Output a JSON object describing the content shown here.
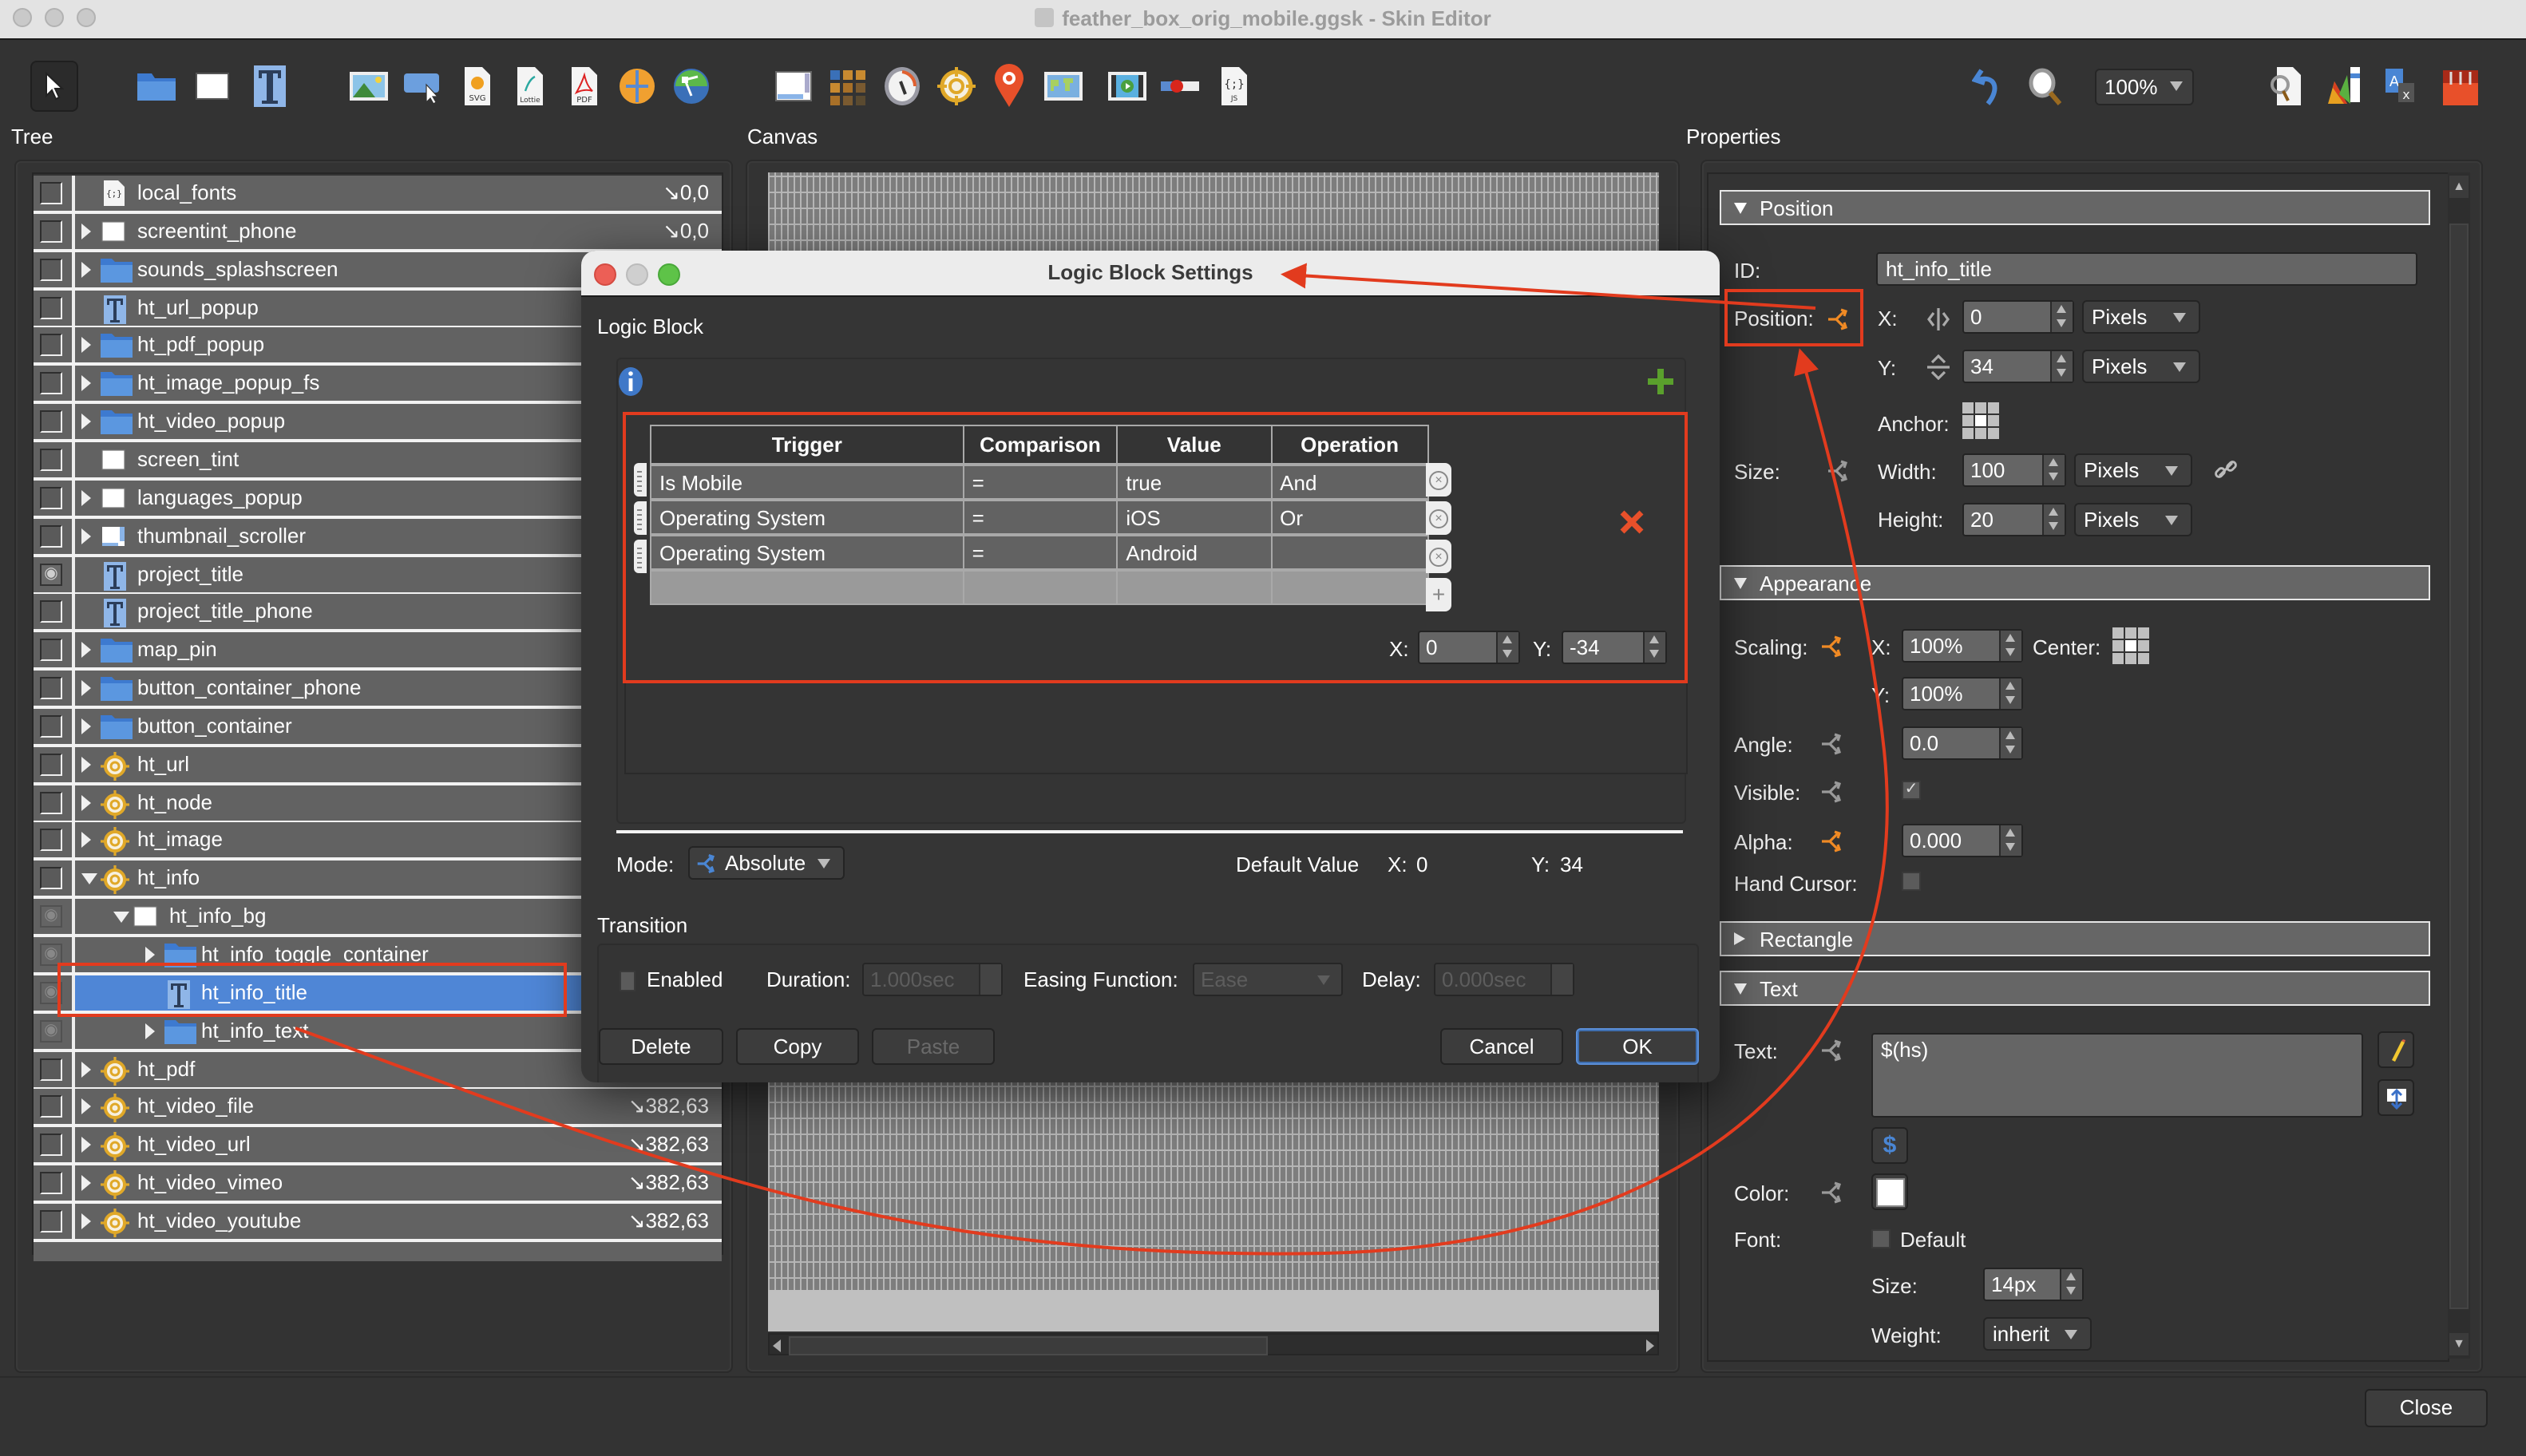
{
  "window": {
    "title": "feather_box_orig_mobile.ggsk - Skin Editor"
  },
  "toolbar": {
    "tools": [
      {
        "name": "select-tool-icon"
      },
      {
        "name": "container-icon"
      },
      {
        "name": "rectangle-icon"
      },
      {
        "name": "text-icon"
      },
      {
        "name": "image-icon"
      },
      {
        "name": "button-icon"
      },
      {
        "name": "svg-icon"
      },
      {
        "name": "lottie-icon"
      },
      {
        "name": "pdf-icon"
      },
      {
        "name": "cloner-icon"
      },
      {
        "name": "node-graph-icon"
      },
      {
        "name": "scrollarea-icon"
      },
      {
        "name": "grid-icon"
      },
      {
        "name": "compass-icon"
      },
      {
        "name": "hotspot-icon"
      },
      {
        "name": "map-pin-icon"
      },
      {
        "name": "map-icon"
      },
      {
        "name": "video-icon"
      },
      {
        "name": "slider-icon"
      },
      {
        "name": "javascript-icon"
      }
    ],
    "zoom_value": "100%",
    "right_tools": [
      {
        "name": "undo-icon"
      },
      {
        "name": "zoom-icon"
      },
      {
        "name": "find-icon"
      },
      {
        "name": "theme-icon"
      },
      {
        "name": "translate-icon"
      },
      {
        "name": "toolbox-icon"
      }
    ]
  },
  "tree": {
    "label": "Tree",
    "rows": [
      {
        "name": "local_fonts",
        "icon": "js",
        "depth": 0,
        "expander": "none",
        "value": "↘0,0",
        "visibility": "off"
      },
      {
        "name": "screentint_phone",
        "icon": "rect",
        "depth": 0,
        "expander": "right",
        "value": "↘0,0",
        "visibility": "off"
      },
      {
        "name": "sounds_splashscreen",
        "icon": "folder",
        "depth": 0,
        "expander": "right",
        "value": "",
        "visibility": "off"
      },
      {
        "name": "ht_url_popup",
        "icon": "text",
        "depth": 0,
        "expander": "none",
        "value": "",
        "visibility": "off"
      },
      {
        "name": "ht_pdf_popup",
        "icon": "folder",
        "depth": 0,
        "expander": "right",
        "value": "",
        "visibility": "off"
      },
      {
        "name": "ht_image_popup_fs",
        "icon": "folder",
        "depth": 0,
        "expander": "right",
        "value": "",
        "visibility": "off"
      },
      {
        "name": "ht_video_popup",
        "icon": "folder",
        "depth": 0,
        "expander": "right",
        "value": "",
        "visibility": "off"
      },
      {
        "name": "screen_tint",
        "icon": "rect",
        "depth": 0,
        "expander": "none",
        "value": "",
        "visibility": "off"
      },
      {
        "name": "languages_popup",
        "icon": "rect",
        "depth": 0,
        "expander": "right",
        "value": "",
        "visibility": "off"
      },
      {
        "name": "thumbnail_scroller",
        "icon": "scroller",
        "depth": 0,
        "expander": "right",
        "value": "",
        "visibility": "off"
      },
      {
        "name": "project_title",
        "icon": "text",
        "depth": 0,
        "expander": "none",
        "value": "",
        "visibility": "eye"
      },
      {
        "name": "project_title_phone",
        "icon": "text",
        "depth": 0,
        "expander": "none",
        "value": "",
        "visibility": "off"
      },
      {
        "name": "map_pin",
        "icon": "folder",
        "depth": 0,
        "expander": "right",
        "value": "",
        "visibility": "off"
      },
      {
        "name": "button_container_phone",
        "icon": "folder",
        "depth": 0,
        "expander": "right",
        "value": "",
        "visibility": "off"
      },
      {
        "name": "button_container",
        "icon": "folder",
        "depth": 0,
        "expander": "right",
        "value": "",
        "visibility": "off"
      },
      {
        "name": "ht_url",
        "icon": "hotspot",
        "depth": 0,
        "expander": "right",
        "value": "",
        "visibility": "off"
      },
      {
        "name": "ht_node",
        "icon": "hotspot",
        "depth": 0,
        "expander": "right",
        "value": "",
        "visibility": "off"
      },
      {
        "name": "ht_image",
        "icon": "hotspot",
        "depth": 0,
        "expander": "right",
        "value": "",
        "visibility": "off"
      },
      {
        "name": "ht_info",
        "icon": "hotspot",
        "depth": 0,
        "expander": "down",
        "value": "",
        "visibility": "off"
      },
      {
        "name": "ht_info_bg",
        "icon": "rect",
        "depth": 1,
        "expander": "down",
        "value": "",
        "visibility": "eye-dim"
      },
      {
        "name": "ht_info_toggle_container",
        "icon": "folder",
        "depth": 2,
        "expander": "right",
        "value": "",
        "visibility": "eye-dim"
      },
      {
        "name": "ht_info_title",
        "icon": "text",
        "depth": 2,
        "expander": "none",
        "value": "",
        "visibility": "eye-dim",
        "selected": true
      },
      {
        "name": "ht_info_text",
        "icon": "folder",
        "depth": 2,
        "expander": "right",
        "value": "",
        "visibility": "eye-dim"
      },
      {
        "name": "ht_pdf",
        "icon": "hotspot",
        "depth": 0,
        "expander": "right",
        "value": "",
        "visibility": "off"
      },
      {
        "name": "ht_video_file",
        "icon": "hotspot",
        "depth": 0,
        "expander": "right",
        "value": "↘382,63",
        "visibility": "off"
      },
      {
        "name": "ht_video_url",
        "icon": "hotspot",
        "depth": 0,
        "expander": "right",
        "value": "↘382,63",
        "visibility": "off"
      },
      {
        "name": "ht_video_vimeo",
        "icon": "hotspot",
        "depth": 0,
        "expander": "right",
        "value": "↘382,63",
        "visibility": "off"
      },
      {
        "name": "ht_video_youtube",
        "icon": "hotspot",
        "depth": 0,
        "expander": "right",
        "value": "↘382,63",
        "visibility": "off"
      }
    ]
  },
  "canvas": {
    "label": "Canvas"
  },
  "properties": {
    "label": "Properties",
    "position": {
      "header": "Position",
      "id_label": "ID:",
      "id_value": "ht_info_title",
      "position_label": "Position:",
      "x_label": "X:",
      "x_value": "0",
      "x_unit": "Pixels",
      "y_label": "Y:",
      "y_value": "34",
      "y_unit": "Pixels",
      "anchor_label": "Anchor:",
      "size_label": "Size:",
      "width_label": "Width:",
      "width_value": "100",
      "width_unit": "Pixels",
      "height_label": "Height:",
      "height_value": "20",
      "height_unit": "Pixels"
    },
    "appearance": {
      "header": "Appearance",
      "scaling_label": "Scaling:",
      "scale_x_label": "X:",
      "scale_x_value": "100%",
      "center_label": "Center:",
      "scale_y_label": "Y:",
      "scale_y_value": "100%",
      "angle_label": "Angle:",
      "angle_value": "0.0",
      "visible_label": "Visible:",
      "visible_checked": true,
      "alpha_label": "Alpha:",
      "alpha_value": "0.000",
      "hand_cursor_label": "Hand Cursor:",
      "hand_cursor_checked": false
    },
    "rectangle": {
      "header": "Rectangle"
    },
    "text": {
      "header": "Text",
      "text_label": "Text:",
      "text_value": "$(hs)",
      "color_label": "Color:",
      "color_value": "#ffffff",
      "font_label": "Font:",
      "font_default_label": "Default",
      "size_label": "Size:",
      "size_value": "14px",
      "weight_label": "Weight:",
      "weight_value": "inherit"
    },
    "logic_colors": {
      "active": "#f08a24",
      "inactive": "#9a9a9a"
    }
  },
  "footer": {
    "close_label": "Close"
  },
  "dialog": {
    "title": "Logic Block Settings",
    "logic_block_label": "Logic Block",
    "table": {
      "headers": [
        "Trigger",
        "Comparison",
        "Value",
        "Operation"
      ],
      "rows": [
        [
          "Is Mobile",
          "=",
          "true",
          "And"
        ],
        [
          "Operating System",
          "=",
          "iOS",
          "Or"
        ],
        [
          "Operating System",
          "=",
          "Android",
          ""
        ]
      ]
    },
    "x_label": "X:",
    "x_value": "0",
    "y_label": "Y:",
    "y_value": "-34",
    "mode_label": "Mode:",
    "mode_value": "Absolute",
    "default_value_label": "Default Value",
    "default_x_label": "X:",
    "default_x_value": "0",
    "default_y_label": "Y:",
    "default_y_value": "34",
    "transition_label": "Transition",
    "enabled_label": "Enabled",
    "enabled_checked": false,
    "duration_label": "Duration:",
    "duration_value": "1.000sec",
    "easing_label": "Easing Function:",
    "easing_value": "Ease",
    "delay_label": "Delay:",
    "delay_value": "0.000sec",
    "buttons": {
      "delete": "Delete",
      "copy": "Copy",
      "paste": "Paste",
      "cancel": "Cancel",
      "ok": "OK"
    }
  },
  "annotation": {
    "color": "#e23b1e"
  }
}
